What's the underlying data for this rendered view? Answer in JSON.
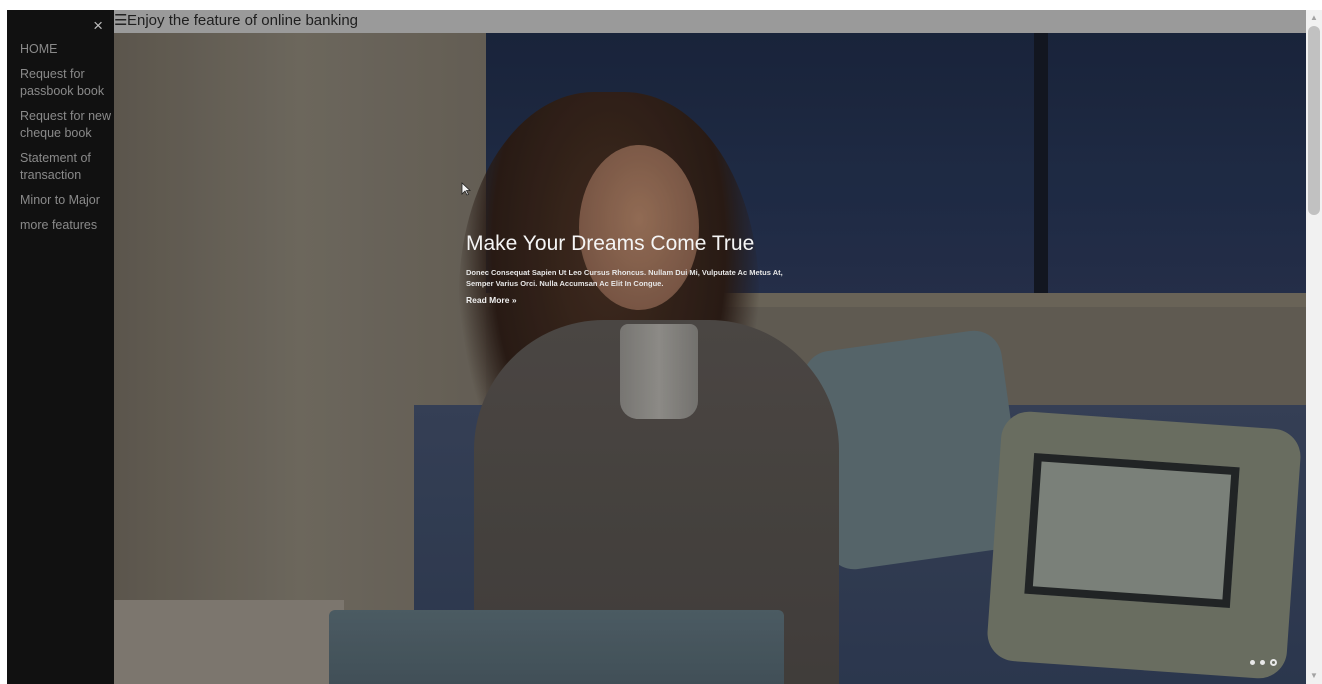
{
  "sidebar": {
    "close_symbol": "×",
    "items": [
      {
        "label": "HOME"
      },
      {
        "label": "Request for passbook book"
      },
      {
        "label": "Request for new cheque book"
      },
      {
        "label": "Statement of transaction"
      },
      {
        "label": "Minor to Major"
      },
      {
        "label": "more features"
      }
    ]
  },
  "topbar": {
    "menu_icon": "hamburger-icon",
    "menu_symbol": "☰",
    "title": "Enjoy the feature of online banking"
  },
  "hero": {
    "heading": "Make Your Dreams Come True",
    "description": "Donec Consequat Sapien Ut Leo Cursus Rhoncus. Nullam Dui Mi, Vulputate Ac Metus At, Semper Varius Orci. Nulla Accumsan Ac Elit In Congue.",
    "read_more": "Read More »",
    "carousel": {
      "count": 3,
      "active_index": 3
    }
  },
  "colors": {
    "sidebar_background": "#111111",
    "topbar_background": "#9a9a9a",
    "sidebar_text": "#8a8a8a"
  },
  "scrollbar": {
    "up_symbol": "▲",
    "down_symbol": "▼"
  }
}
